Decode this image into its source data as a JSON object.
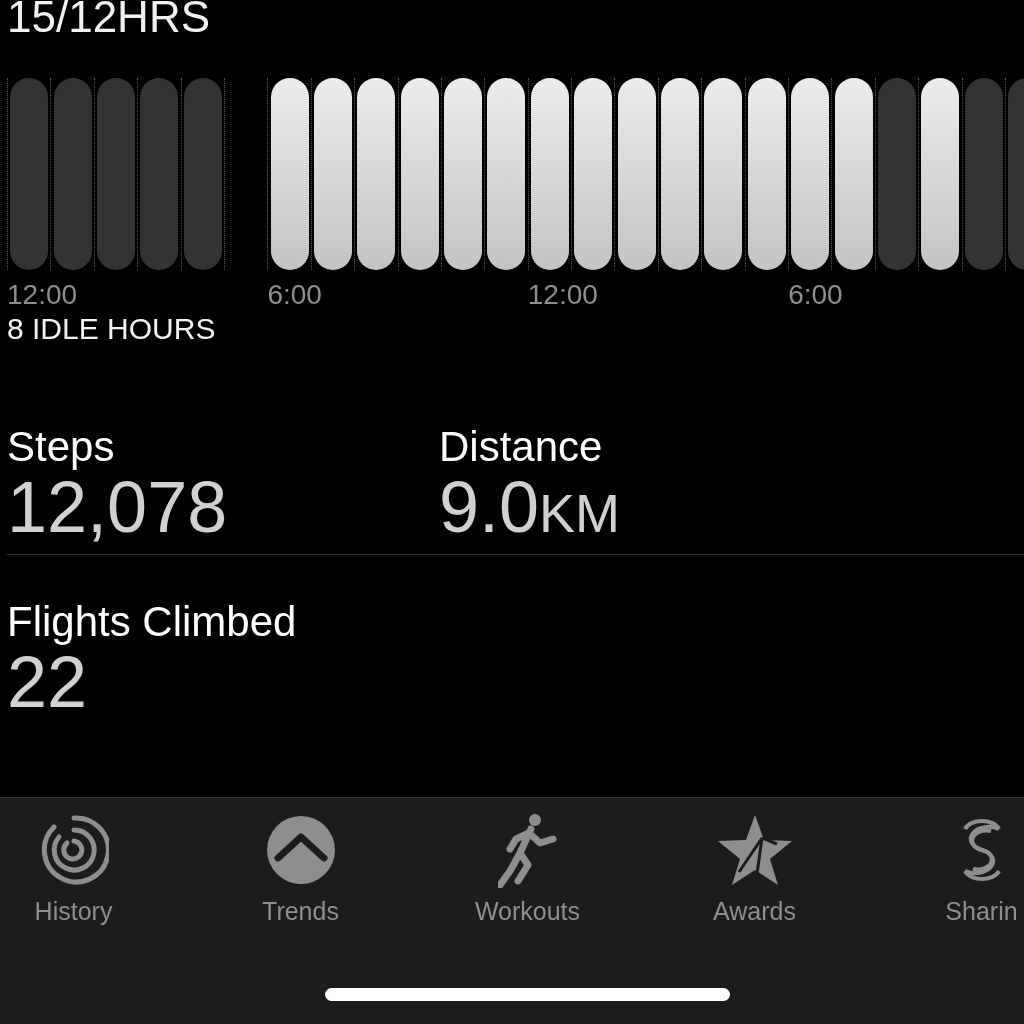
{
  "stand": {
    "title": "15/12HRS",
    "hours": [
      {
        "kind": "idle"
      },
      {
        "kind": "idle"
      },
      {
        "kind": "idle"
      },
      {
        "kind": "idle"
      },
      {
        "kind": "idle"
      },
      {
        "kind": "none"
      },
      {
        "kind": "stood"
      },
      {
        "kind": "stood"
      },
      {
        "kind": "stood"
      },
      {
        "kind": "stood"
      },
      {
        "kind": "stood"
      },
      {
        "kind": "stood"
      },
      {
        "kind": "stood"
      },
      {
        "kind": "stood"
      },
      {
        "kind": "stood"
      },
      {
        "kind": "stood"
      },
      {
        "kind": "stood"
      },
      {
        "kind": "stood"
      },
      {
        "kind": "stood"
      },
      {
        "kind": "stood"
      },
      {
        "kind": "idle"
      },
      {
        "kind": "stood"
      },
      {
        "kind": "idle"
      },
      {
        "kind": "idle"
      }
    ],
    "ticks": [
      "12:00",
      "6:00",
      "12:00",
      "6:00"
    ],
    "summary": "8 IDLE HOURS"
  },
  "stats": [
    {
      "label": "Steps",
      "value": "12,078"
    },
    {
      "label": "Distance",
      "value": "9.0",
      "unit": "KM"
    }
  ],
  "flights": {
    "label": "Flights Climbed",
    "value": "22"
  },
  "tab_bar": [
    {
      "kind": "history",
      "label": "History",
      "selected": false
    },
    {
      "kind": "trends",
      "label": "Trends",
      "selected": false
    },
    {
      "kind": "workouts",
      "label": "Workouts",
      "selected": false
    },
    {
      "kind": "awards",
      "label": "Awards",
      "selected": false
    },
    {
      "kind": "sharing",
      "label": "Sharin",
      "selected": false
    }
  ]
}
